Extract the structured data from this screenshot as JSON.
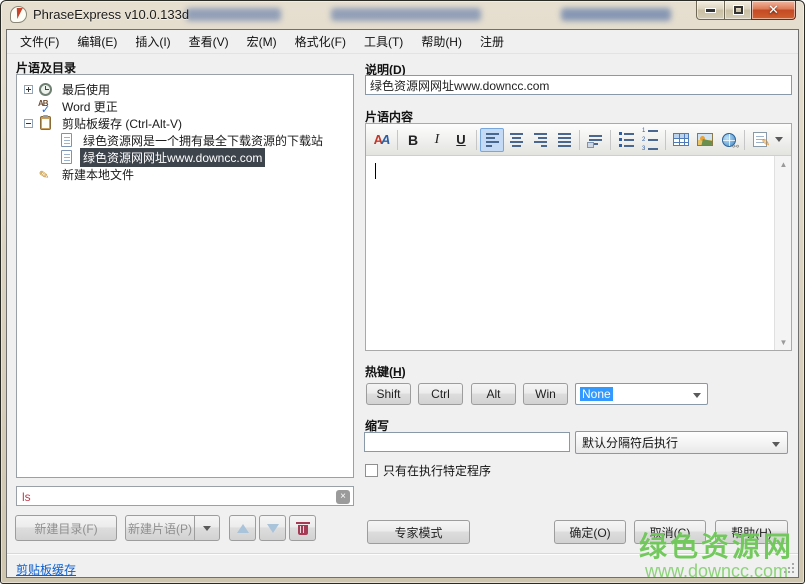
{
  "window": {
    "title": "PhraseExpress v10.0.133d",
    "controls": {
      "minimize": "minimize",
      "maximize": "maximize",
      "close": "close"
    }
  },
  "menu": {
    "items": [
      "文件(F)",
      "编辑(E)",
      "插入(I)",
      "查看(V)",
      "宏(M)",
      "格式化(F)",
      "工具(T)",
      "帮助(H)",
      "注册"
    ]
  },
  "left": {
    "header": "片语及目录",
    "tree": [
      {
        "label": "最后使用",
        "icon": "clock-icon",
        "expander": "plus",
        "level": 0,
        "selected": false
      },
      {
        "label": "Word 更正",
        "icon": "word-autocorrect-icon",
        "expander": "none",
        "level": 0,
        "selected": false
      },
      {
        "label": "剪贴板缓存 (Ctrl-Alt-V)",
        "icon": "clipboard-icon",
        "expander": "minus",
        "level": 0,
        "selected": false
      },
      {
        "label": "绿色资源网是一个拥有最全下载资源的下载站",
        "icon": "document-icon",
        "expander": "none",
        "level": 1,
        "selected": false
      },
      {
        "label": "绿色资源网网址www.downcc.com",
        "icon": "document-icon",
        "expander": "none",
        "level": 1,
        "selected": true
      },
      {
        "label": "新建本地文件",
        "icon": "pencil-icon",
        "expander": "none",
        "level": 0,
        "selected": false
      }
    ],
    "search": {
      "value": "ls",
      "clear": "×"
    },
    "buttons": {
      "new_folder": "新建目录(F)",
      "new_phrase": "新建片语(P)"
    }
  },
  "right": {
    "description": {
      "label_pre": "说明(",
      "label_mn": "D",
      "label_post": ")",
      "value": "绿色资源网网址www.downcc.com"
    },
    "content_label": "片语内容",
    "toolbar_icons": [
      "font-icon",
      "bold-icon",
      "italic-icon",
      "underline-icon",
      "align-left-icon",
      "align-center-icon",
      "align-right-icon",
      "justify-icon",
      "paragraph-indent-icon",
      "bullet-list-icon",
      "numbered-list-icon",
      "table-icon",
      "image-icon",
      "hyperlink-globe-icon",
      "edit-note-icon",
      "toolbar-dropdown-arrow-icon"
    ],
    "hotkey": {
      "label_pre": "热键(",
      "label_mn": "H",
      "label_post": ")",
      "buttons": [
        "Shift",
        "Ctrl",
        "Alt",
        "Win"
      ],
      "combo_value": "None"
    },
    "abbreviation": {
      "label": "缩写",
      "value": "",
      "delimiter_combo_value": "默认分隔符后执行"
    },
    "checkbox_label": "只有在执行特定程序",
    "expert_button": "专家模式",
    "ok_button": "确定(O)",
    "cancel_button": "取消(C)",
    "help_button": "帮助(H)"
  },
  "statusbar": {
    "link": "剪贴板缓存"
  },
  "watermark": {
    "line1": "绿色资源网",
    "line2": "www.downcc.com",
    "color": "#60c148"
  },
  "colors": {
    "selection": "#3399ff",
    "tree_selected_bg": "#3d444c",
    "close_button": "#c34a24",
    "search_text": "#c23b4e"
  }
}
